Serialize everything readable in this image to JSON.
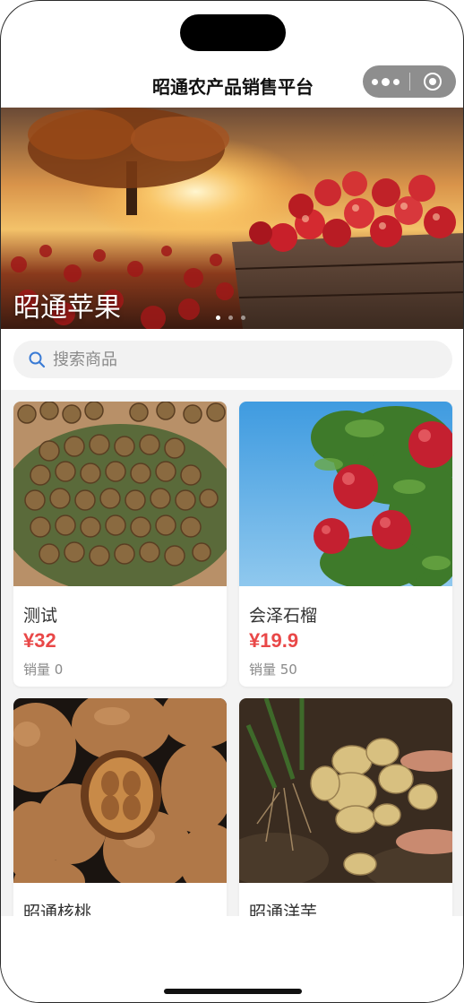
{
  "nav": {
    "title": "昭通农产品销售平台"
  },
  "banner": {
    "caption": "昭通苹果",
    "slide_count": 3,
    "active_slide": 1
  },
  "search": {
    "placeholder": "搜索商品",
    "value": ""
  },
  "products": [
    {
      "name": "测试",
      "price": "¥32",
      "sales": "销量 0",
      "image": "walnuts-on-leaf"
    },
    {
      "name": "会泽石榴",
      "price": "¥19.9",
      "sales": "销量 50",
      "image": "pomegranates-on-tree"
    },
    {
      "name": "昭通核桃",
      "price": "",
      "sales": "",
      "image": "walnuts-closeup"
    },
    {
      "name": "昭通洋芋",
      "price": "",
      "sales": "",
      "image": "potatoes-in-hands"
    }
  ],
  "colors": {
    "price": "#e94848",
    "grid_background": "#f3f3f3",
    "capsule": "#8e8e8e"
  }
}
